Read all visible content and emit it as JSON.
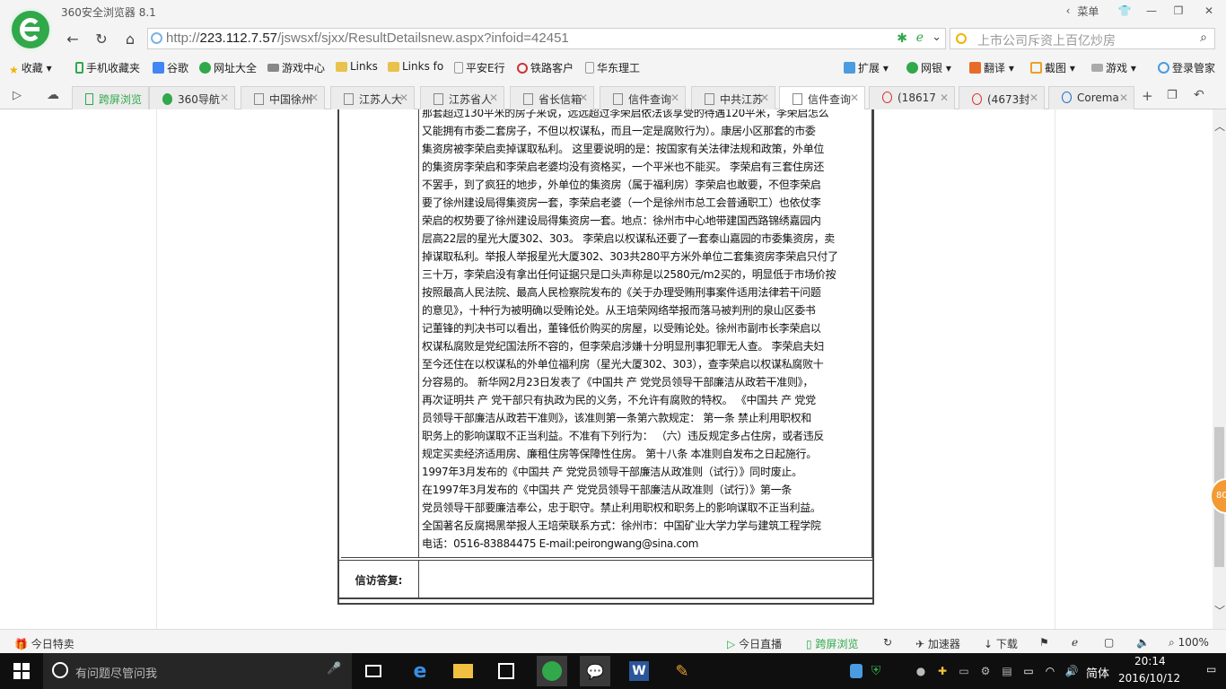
{
  "browser": {
    "title": "360安全浏览器 8.1",
    "menu_label": "菜单",
    "url_prefix": "http://",
    "url_host": "223.112.7.57",
    "url_path": "/jswsxf/sjxx/ResultDetailsnew.aspx?infoid=42451",
    "search_placeholder": "上市公司斥资上百亿炒房",
    "accent": "#31a84a"
  },
  "bookmarks": [
    {
      "label": "收藏",
      "icon": "star-icon",
      "color": "#f0b400"
    },
    {
      "label": "手机收藏夹",
      "icon": "phone-icon",
      "color": "#31a84a"
    },
    {
      "label": "谷歌",
      "icon": "google-icon",
      "color": "#4285f4"
    },
    {
      "label": "网址大全",
      "icon": "360-icon",
      "color": "#31a84a"
    },
    {
      "label": "游戏中心",
      "icon": "gamepad-icon",
      "color": "#777"
    },
    {
      "label": "Links",
      "icon": "folder-icon",
      "color": "#e8c24a"
    },
    {
      "label": "Links fo",
      "icon": "folder-icon",
      "color": "#e8c24a"
    },
    {
      "label": "平安E行",
      "icon": "page-icon",
      "color": "#999"
    },
    {
      "label": "铁路客户",
      "icon": "rail-icon",
      "color": "#c33"
    },
    {
      "label": "华东理工",
      "icon": "page-icon",
      "color": "#999"
    }
  ],
  "toolbar_right": [
    "扩展",
    "网银",
    "翻译",
    "截图",
    "游戏",
    "登录管家"
  ],
  "tabs": [
    {
      "label": "跨屏浏览",
      "active": false
    },
    {
      "label": "360导航",
      "active": false
    },
    {
      "label": "中国徐州",
      "active": false
    },
    {
      "label": "江苏人大",
      "active": false
    },
    {
      "label": "江苏省人",
      "active": false
    },
    {
      "label": "省长信箱",
      "active": false
    },
    {
      "label": "信件查询",
      "active": false
    },
    {
      "label": "中共江苏",
      "active": false
    },
    {
      "label": "信件查询",
      "active": true
    },
    {
      "label": "(18617",
      "active": false
    },
    {
      "label": "(4673封",
      "active": false
    },
    {
      "label": "Corema",
      "active": false
    }
  ],
  "letter_lines": [
    "那套超过130平米的房子来说，远远超过李荣启依法该享受的待遇120平米，李荣启怎么",
    "又能拥有市委二套房子，不但以权谋私，而且一定是腐败行为）。康居小区那套的市委",
    "集资房被李荣启卖掉谋取私利。 这里要说明的是：按国家有关法律法规和政策，外单位",
    "的集资房李荣启和李荣启老婆均没有资格买，一个平米也不能买。 李荣启有三套住房还",
    "不罢手，到了疯狂的地步，外单位的集资房（属于福利房）李荣启也敢要，不但李荣启",
    "要了徐州建设局得集资房一套，李荣启老婆（一个是徐州市总工会普通职工）也依仗李",
    "荣启的权势要了徐州建设局得集资房一套。地点：徐州市中心地带建国西路锦绣嘉园内",
    "层高22层的星光大厦302、303。 李荣启以权谋私还要了一套泰山嘉园的市委集资房，卖",
    "掉谋取私利。举报人举报星光大厦302、303共280平方米外单位二套集资房李荣启只付了",
    "三十万，李荣启没有拿出任何证据只是口头声称是以2580元/m2买的，明显低于市场价按",
    "按照最高人民法院、最高人民检察院发布的《关于办理受贿刑事案件适用法律若干问题",
    "的意见》，十种行为被明确以受贿论处。从王培荣网络举报而落马被判刑的泉山区委书",
    "记董锋的判决书可以看出，董锋低价购买的房屋，以受贿论处。徐州市副市长李荣启以",
    "权谋私腐败是党纪国法所不容的，但李荣启涉嫌十分明显刑事犯罪无人查。 李荣启夫妇",
    "至今还住在以权谋私的外单位福利房（星光大厦302、303），查李荣启以权谋私腐败十",
    "分容易的。 新华网2月23日发表了《中国共 产 党党员领导干部廉洁从政若干准则》，",
    "再次证明共 产 党干部只有执政为民的义务，不允许有腐败的特权。 《中国共 产 党党",
    "员领导干部廉洁从政若干准则》，该准则第一条第六款规定： 第一条 禁止利用职权和",
    "职务上的影响谋取不正当利益。不准有下列行为： （六）违反规定多占住房，或者违反",
    "规定买卖经济适用房、廉租住房等保障性住房。 第十八条 本准则自发布之日起施行。",
    "1997年3月发布的《中国共 产 党党员领导干部廉洁从政准则（试行）》同时废止。",
    "在1997年3月发布的《中国共 产 党党员领导干部廉洁从政准则（试行）》第一条",
    "党员领导干部要廉洁奉公，忠于职守。禁止利用职权和职务上的影响谋取不正当利益。",
    "全国著名反腐揭黑举报人王培荣联系方式：徐州市：中国矿业大学力学与建筑工程学院",
    "电话：0516-83884475 E-mail:peirongwang@sina.com"
  ],
  "reply_label": "信访答复:",
  "side_badge": "80",
  "statusbar": {
    "left": "今日特卖",
    "live": "今日直播",
    "cross_screen": "跨屏浏览",
    "accelerator": "加速器",
    "download": "下载",
    "zoom": "100%"
  },
  "taskbar": {
    "search_placeholder": "有问题尽管问我",
    "ime": "简体",
    "time": "20:14",
    "date": "2016/10/12"
  }
}
